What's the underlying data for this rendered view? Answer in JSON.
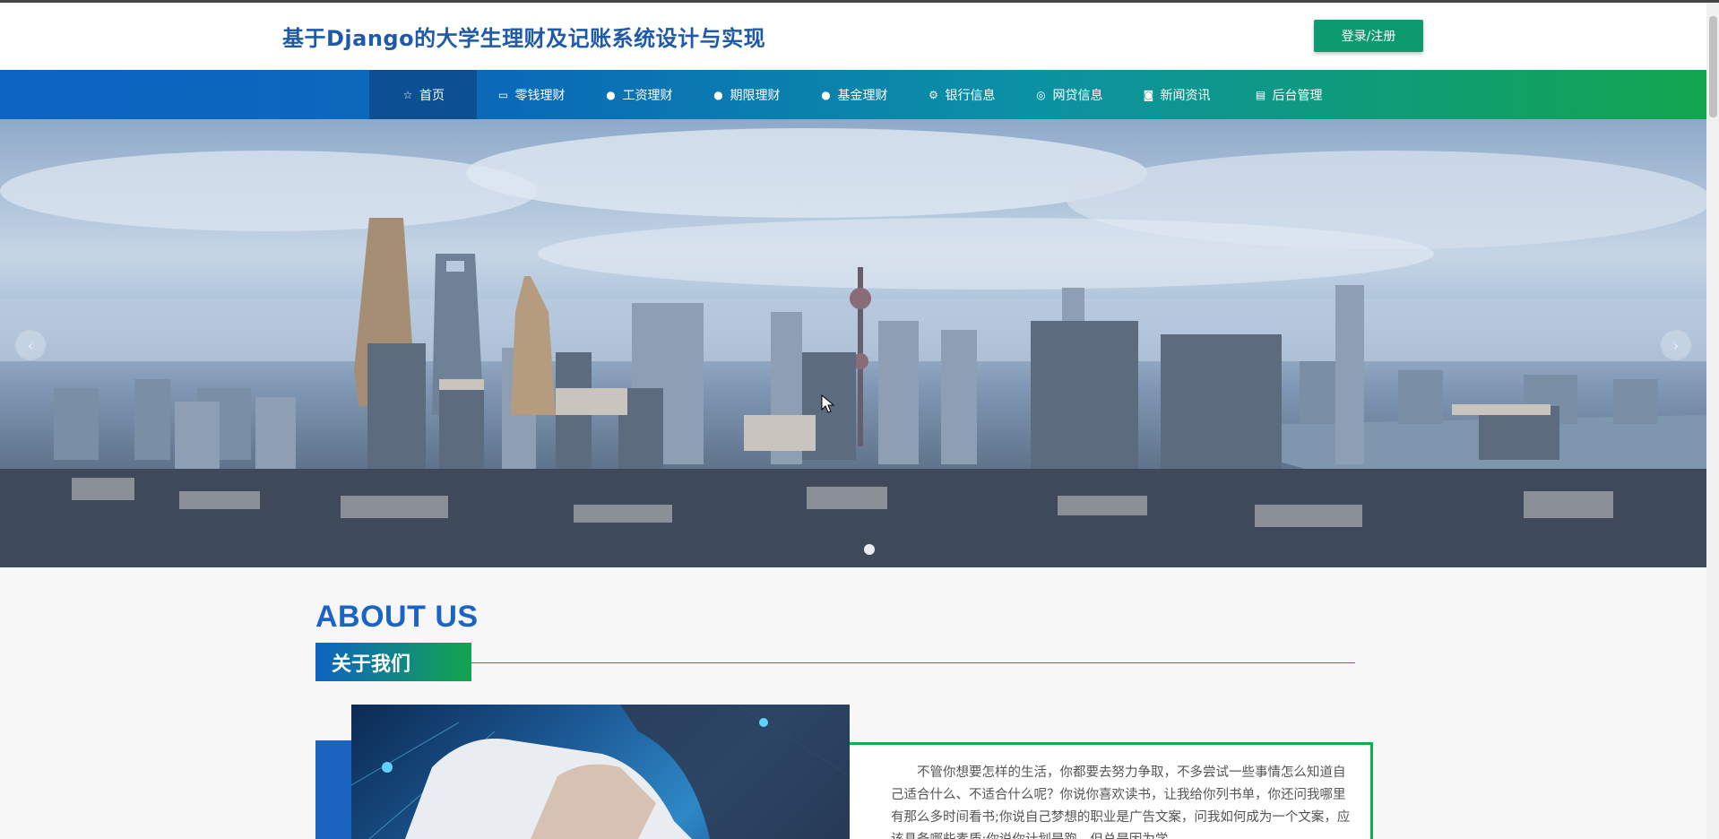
{
  "header": {
    "title": "基于Django的大学生理财及记账系统设计与实现",
    "login_label": "登录/注册"
  },
  "nav": {
    "items": [
      {
        "label": "首页",
        "icon": "star-icon",
        "active": true
      },
      {
        "label": "零钱理财",
        "icon": "wallet-icon"
      },
      {
        "label": "工资理财",
        "icon": "info-icon"
      },
      {
        "label": "期限理财",
        "icon": "circle-icon"
      },
      {
        "label": "基金理财",
        "icon": "info-icon"
      },
      {
        "label": "银行信息",
        "icon": "gear-icon"
      },
      {
        "label": "网贷信息",
        "icon": "globe-icon"
      },
      {
        "label": "新闻资讯",
        "icon": "camera-icon"
      },
      {
        "label": "后台管理",
        "icon": "clipboard-icon"
      }
    ]
  },
  "banner": {
    "prev_label": "‹",
    "next_label": "›"
  },
  "about": {
    "title_en": "ABOUT US",
    "title_cn": "关于我们",
    "text": "不管你想要怎样的生活，你都要去努力争取，不多尝试一些事情怎么知道自己适合什么、不适合什么呢？你说你喜欢读书，让我给你列书单，你还问我哪里有那么多时间看书;你说自己梦想的职业是广告文案，问我如何成为一个文案，应该具备哪些素质;你说你计划是跑，但总是因为学"
  },
  "colors": {
    "brand_blue": "#1c63c7",
    "brand_green": "#13a54e",
    "login_green": "#0e9a6f"
  }
}
